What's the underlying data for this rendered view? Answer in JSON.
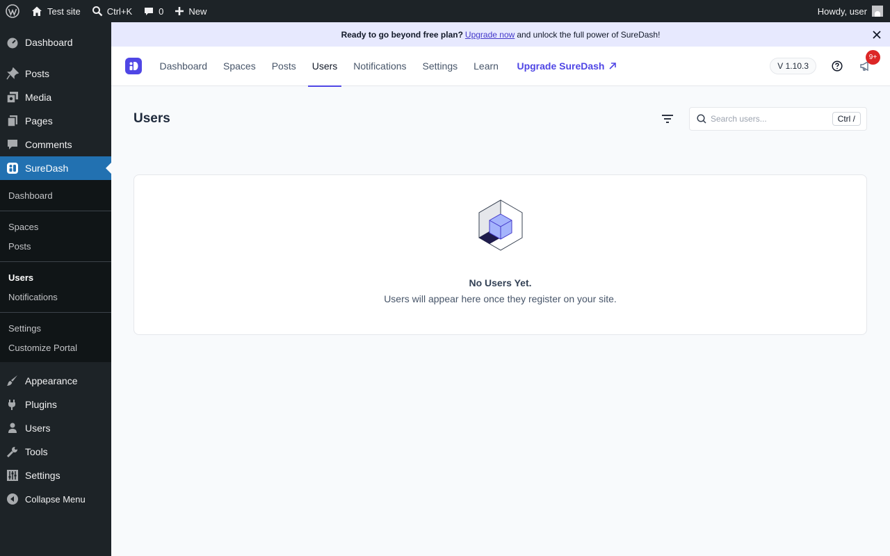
{
  "adminbar": {
    "site_name": "Test site",
    "search_shortcut": "Ctrl+K",
    "comments_count": "0",
    "new_label": "New",
    "howdy": "Howdy, user"
  },
  "sidebar": {
    "items_top": [
      {
        "label": "Dashboard",
        "icon": "dashboard-icon"
      },
      {
        "label": "Posts",
        "icon": "pin-icon"
      },
      {
        "label": "Media",
        "icon": "media-icon"
      },
      {
        "label": "Pages",
        "icon": "pages-icon"
      },
      {
        "label": "Comments",
        "icon": "comment-icon"
      },
      {
        "label": "SureDash",
        "icon": "suredash-icon"
      }
    ],
    "submenu": [
      "Dashboard",
      "Spaces",
      "Posts",
      "Users",
      "Notifications",
      "Settings",
      "Customize Portal"
    ],
    "items_bottom": [
      {
        "label": "Appearance",
        "icon": "brush-icon"
      },
      {
        "label": "Plugins",
        "icon": "plugin-icon"
      },
      {
        "label": "Users",
        "icon": "user-icon"
      },
      {
        "label": "Tools",
        "icon": "wrench-icon"
      },
      {
        "label": "Settings",
        "icon": "settings-icon"
      },
      {
        "label": "Collapse Menu",
        "icon": "collapse-icon"
      }
    ]
  },
  "banner": {
    "bold_text": "Ready to go beyond free plan?",
    "link_text": "Upgrade now",
    "rest_text": "and unlock the full power of SureDash!"
  },
  "topnav": {
    "links": [
      "Dashboard",
      "Spaces",
      "Posts",
      "Users",
      "Notifications",
      "Settings",
      "Learn"
    ],
    "active": "Users",
    "upgrade_label": "Upgrade SureDash",
    "version": "V 1.10.3",
    "badge": "9+"
  },
  "page": {
    "title": "Users",
    "search_placeholder": "Search users...",
    "search_shortcut": "Ctrl /"
  },
  "empty_state": {
    "title": "No Users Yet.",
    "description": "Users will appear here once they register on your site."
  },
  "colors": {
    "accent": "#4f46e5",
    "wp_dark": "#1d2327",
    "wp_blue": "#2271b1",
    "badge": "#dc2626"
  }
}
